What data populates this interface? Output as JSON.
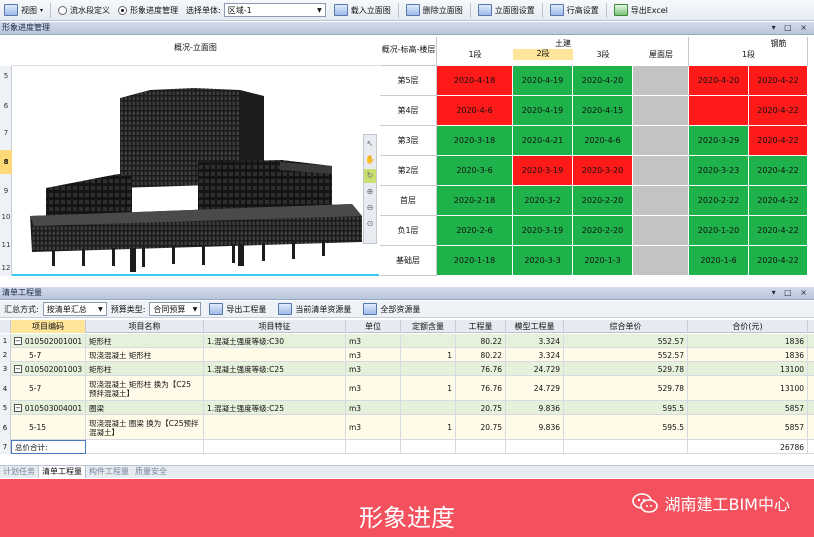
{
  "toolbar": {
    "view": "视图",
    "mode_flow": "流水段定义",
    "mode_image": "形象进度管理",
    "select_unit_label": "选择单体:",
    "select_unit_value": "区域-1",
    "load_elevation": "载入立面图",
    "delete_elevation": "删除立面图",
    "elevation_settings": "立面图设置",
    "row_height_settings": "行高设置",
    "export_excel": "导出Excel"
  },
  "progress_panel": {
    "title": "形象进度管理",
    "view_title": "概况-立面图",
    "grid_corner": "概况-标高-楼层",
    "group_civil": "土建",
    "group_rebar": "钢筋",
    "col_labels": [
      "1段",
      "2段",
      "3段",
      "屋面层",
      "1段"
    ],
    "row_numbers": [
      "5",
      "6",
      "7",
      "8",
      "9",
      "10",
      "11",
      "12"
    ],
    "floors": [
      {
        "name": "第5层",
        "cells": [
          {
            "t": "2020-4-18",
            "c": "red"
          },
          {
            "t": "2020-4-19",
            "c": "green"
          },
          {
            "t": "2020-4-20",
            "c": "green"
          },
          {
            "t": "",
            "c": "gray"
          },
          {
            "t": "2020-4-20",
            "c": "red"
          },
          {
            "t": "2020-4-22",
            "c": "red"
          }
        ]
      },
      {
        "name": "第4层",
        "cells": [
          {
            "t": "2020-4-6",
            "c": "red"
          },
          {
            "t": "2020-4-19",
            "c": "green"
          },
          {
            "t": "2020-4-15",
            "c": "green"
          },
          {
            "t": "",
            "c": "gray"
          },
          {
            "t": "",
            "c": "red"
          },
          {
            "t": "2020-4-22",
            "c": "red"
          }
        ]
      },
      {
        "name": "第3层",
        "cells": [
          {
            "t": "2020-3-18",
            "c": "green"
          },
          {
            "t": "2020-4-21",
            "c": "green"
          },
          {
            "t": "2020-4-6",
            "c": "green"
          },
          {
            "t": "",
            "c": "gray"
          },
          {
            "t": "2020-3-29",
            "c": "green"
          },
          {
            "t": "2020-4-22",
            "c": "red"
          }
        ]
      },
      {
        "name": "第2层",
        "cells": [
          {
            "t": "2020-3-6",
            "c": "green"
          },
          {
            "t": "2020-3-19",
            "c": "red"
          },
          {
            "t": "2020-3-20",
            "c": "red"
          },
          {
            "t": "",
            "c": "gray"
          },
          {
            "t": "2020-3-23",
            "c": "green"
          },
          {
            "t": "2020-4-22",
            "c": "green"
          }
        ]
      },
      {
        "name": "首层",
        "cells": [
          {
            "t": "2020-2-18",
            "c": "green"
          },
          {
            "t": "2020-3-2",
            "c": "green"
          },
          {
            "t": "2020-2-20",
            "c": "green"
          },
          {
            "t": "",
            "c": "gray"
          },
          {
            "t": "2020-2-22",
            "c": "green"
          },
          {
            "t": "2020-4-22",
            "c": "green"
          }
        ]
      },
      {
        "name": "负1层",
        "cells": [
          {
            "t": "2020-2-6",
            "c": "green"
          },
          {
            "t": "2020-3-19",
            "c": "green"
          },
          {
            "t": "2020-2-20",
            "c": "green"
          },
          {
            "t": "",
            "c": "gray"
          },
          {
            "t": "2020-1-20",
            "c": "green"
          },
          {
            "t": "2020-4-22",
            "c": "green"
          }
        ]
      },
      {
        "name": "基础层",
        "cells": [
          {
            "t": "2020-1-18",
            "c": "green"
          },
          {
            "t": "2020-3-3",
            "c": "green"
          },
          {
            "t": "2020-1-3",
            "c": "green"
          },
          {
            "t": "",
            "c": "gray"
          },
          {
            "t": "2020-1-6",
            "c": "green"
          },
          {
            "t": "2020-4-22",
            "c": "green"
          }
        ]
      }
    ]
  },
  "quantity_panel": {
    "title": "清单工程量",
    "summary_label": "汇总方式:",
    "summary_value": "按清单汇总",
    "budget_label": "预算类型:",
    "budget_value": "合同预算",
    "export_qty": "导出工程量",
    "current_list": "当前清单资源量",
    "all_resources": "全部资源量",
    "headers": [
      "项目编码",
      "项目名称",
      "项目特征",
      "单位",
      "定额含量",
      "工程量",
      "模型工程量",
      "综合单价",
      "合价(元)"
    ],
    "rows": [
      {
        "idx": "1",
        "code": "010502001001",
        "name": "矩形柱",
        "feature": "1.混凝土强度等级:C30",
        "unit": "m3",
        "content": "",
        "qty": "80.22",
        "model_qty": "3.324",
        "price": "552.57",
        "total": "1836"
      },
      {
        "idx": "2",
        "code": "5-7",
        "name": "现浇混凝土 矩形柱",
        "feature": "",
        "unit": "m3",
        "content": "1",
        "qty": "80.22",
        "model_qty": "3.324",
        "price": "552.57",
        "total": "1836"
      },
      {
        "idx": "3",
        "code": "010502001003",
        "name": "矩形柱",
        "feature": "1.混凝土强度等级:C25",
        "unit": "m3",
        "content": "",
        "qty": "76.76",
        "model_qty": "24.729",
        "price": "529.78",
        "total": "13100"
      },
      {
        "idx": "4",
        "code": "5-7",
        "name": "现浇混凝土 矩形柱 换为【C25 预拌混凝土】",
        "feature": "",
        "unit": "m3",
        "content": "1",
        "qty": "76.76",
        "model_qty": "24.729",
        "price": "529.78",
        "total": "13100"
      },
      {
        "idx": "5",
        "code": "010503004001",
        "name": "圈梁",
        "feature": "1.混凝土强度等级:C25",
        "unit": "m3",
        "content": "",
        "qty": "20.75",
        "model_qty": "9.836",
        "price": "595.5",
        "total": "5857"
      },
      {
        "idx": "6",
        "code": "5-15",
        "name": "现浇混凝土 圈梁 换为【C25预拌混凝土】",
        "feature": "",
        "unit": "m3",
        "content": "1",
        "qty": "20.75",
        "model_qty": "9.836",
        "price": "595.5",
        "total": "5857"
      },
      {
        "idx": "7",
        "code": "总价合计:",
        "name": "",
        "feature": "",
        "unit": "",
        "content": "",
        "qty": "",
        "model_qty": "",
        "price": "",
        "total": "26786"
      }
    ]
  },
  "tabs": [
    "计划任务",
    "清单工程量",
    "构件工程量",
    "质量安全"
  ],
  "banner": {
    "title": "形象进度",
    "watermark": "湖南建工BIM中心"
  },
  "colors": {
    "red": "#ff1a1a",
    "green": "#1fb24a",
    "gray": "#c3c3c3",
    "accent": "#f2515d"
  }
}
